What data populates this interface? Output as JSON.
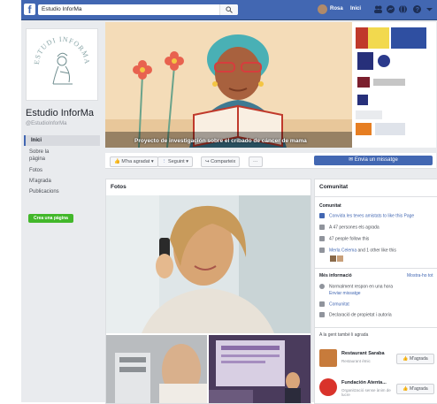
{
  "topbar": {
    "search_value": "Estudio InforMa",
    "user_name": "Rosa",
    "home_label": "Inici",
    "icons": [
      "friends-icon",
      "messages-icon",
      "globe-icon",
      "help-icon",
      "menu-icon"
    ]
  },
  "profile": {
    "logo_text": "ESTUDI INFORMA",
    "name": "Estudio InforMa",
    "handle": "@EstudioInforMa"
  },
  "nav": {
    "items": [
      "Inici",
      "Sobre la pàgina",
      "Fotos",
      "M'agrada",
      "Publicacions"
    ],
    "create_label": "Crea una pàgina"
  },
  "cover": {
    "caption": "Proyecto de investigación sobre el cribado de cáncer de mama"
  },
  "actions": {
    "like_label": "M'ha agradat ▾",
    "follow_label": "Seguint ▾",
    "share_label": "Comparteix",
    "more_label": "···",
    "message_label": "Envia un missatge"
  },
  "photos": {
    "title": "Fotos"
  },
  "community": {
    "title": "Comunitat",
    "section_label": "Comunitat",
    "invite": "Convida les teves amistats to like this Page",
    "likes": "A 47 persones els agrada",
    "follows": "47 people follow this",
    "friends_name": "Merla Celema",
    "friends_rest": "and 1 other like this",
    "info_title": "Més informació",
    "info_link": "Mostra-ho tot",
    "info_items": [
      "Normalment respon en una hora",
      "Enviar missatge",
      "Comunitat",
      "Declaració de propietat i autoria"
    ],
    "likes_title": "A la gent també li agrada",
    "suggestions": [
      {
        "name": "Restaurant Saraba",
        "subtitle": "Restaurant ètnic",
        "button": "M'agrada"
      },
      {
        "name": "Fundación Atenta...",
        "subtitle": "Organització sense ànim de lucre",
        "button": "M'agrada"
      }
    ]
  },
  "colors": {
    "brand_blue": "#4267b2",
    "create_green": "#42b72a",
    "background": "#e9ebee"
  }
}
